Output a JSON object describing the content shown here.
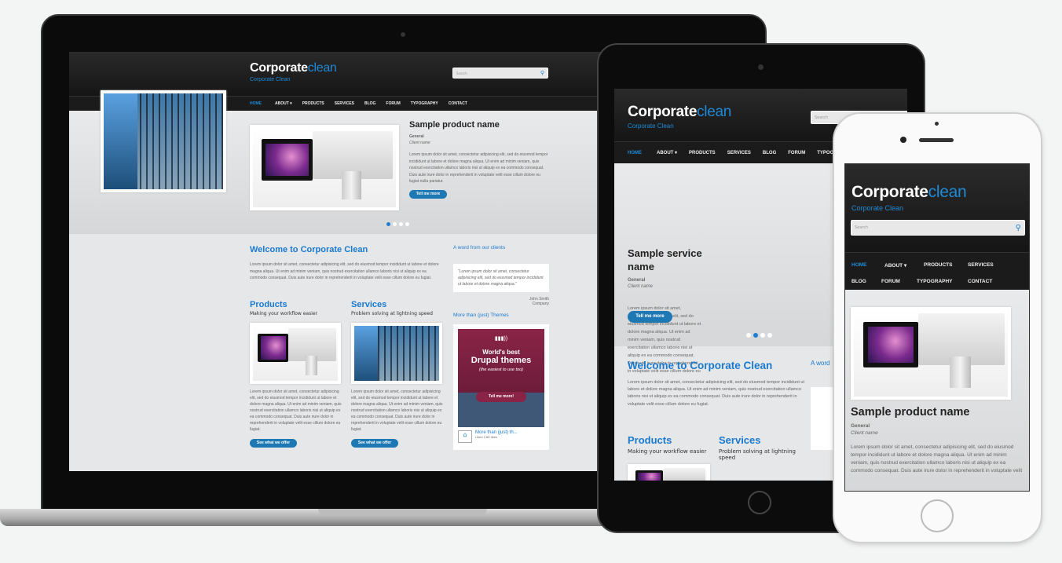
{
  "site": {
    "logo_main": "Corporate",
    "logo_accent": "clean",
    "slogan": "Corporate Clean",
    "search_placeholder": "Search",
    "nav": [
      "HOME",
      "ABOUT ▾",
      "PRODUCTS",
      "SERVICES",
      "BLOG",
      "FORUM",
      "TYPOGRAPHY",
      "CONTACT"
    ],
    "tablet_nav_cut": "TYPOG",
    "hero_product_title": "Sample product name",
    "hero_service_title": "Sample service name",
    "hero_category": "General",
    "hero_client": "Client name",
    "hero_button": "Tell me more",
    "lorem_hero": "Lorem ipsum dolor sit amet, consectetur adipisicing elit, sed do eiusmod tempor incididunt ut labore et dolore magna aliqua. Ut enim ad minim veniam, quis nostrud exercitation ullamco laboris nisi ut aliquip ex ea commodo consequat. Duis aute irure dolor in reprehenderit in voluptate velit esse cillum dolore eu fugiat nulla pariatur.",
    "welcome_title": "Welcome to Corporate Clean",
    "welcome_text": "Lorem ipsum dolor sit amet, consectetur adipisicing elit, sed do eiusmod tempor incididunt ut labore et dolore magna aliqua. Ut enim ad minim veniam, quis nostrud exercitation ullamco laboris nisi ut aliquip ex ea commodo consequat. Duis aute irure dolor in reprehenderit in voluptate velit esse cillum dolore eu fugiat.",
    "products_title": "Products",
    "products_sub": "Making your workflow easier",
    "services_title": "Services",
    "services_sub": "Problem solving at lightning speed",
    "column_text": "Lorem ipsum dolor sit amet, consectetur adipisicing elit, sed do eiusmod tempor incididunt ut labore et dolore magna aliqua. Ut enim ad minim veniam, quis nostrud exercitation ullamco laboris nisi ut aliquip ex ea commodo consequat. Duis aute irure dolor in reprehenderit in voluptate velit esse cillum dolore eu fugiat.",
    "offer_button": "See what we offer",
    "clients_title": "A word from our clients",
    "tablet_clients_cut": "A word",
    "quote": "\"Lorem ipsum dolor sit amet, consectetur adipisicing elit, sed do eiusmod tempor incididunt ut labore et dolore magna aliqua.\"",
    "quote_author": "John Smith",
    "quote_company": "Company",
    "themes_title": "More than (just) Themes",
    "promo_line1": "World's best",
    "promo_line2": "Drupal themes",
    "promo_line3": "(the easiest to use too)",
    "promo_button": "Tell me more!",
    "fb_name": "More than (just) th...",
    "fb_like": "Liked",
    "fb_count": "2.6K likes"
  },
  "colors": {
    "accent": "#1e8ad6",
    "header": "#1b1b1b",
    "button": "#1d78b4",
    "promo": "#8a2447"
  },
  "slider": {
    "laptop_active": 1,
    "tablet_active": 2,
    "count": 4
  }
}
